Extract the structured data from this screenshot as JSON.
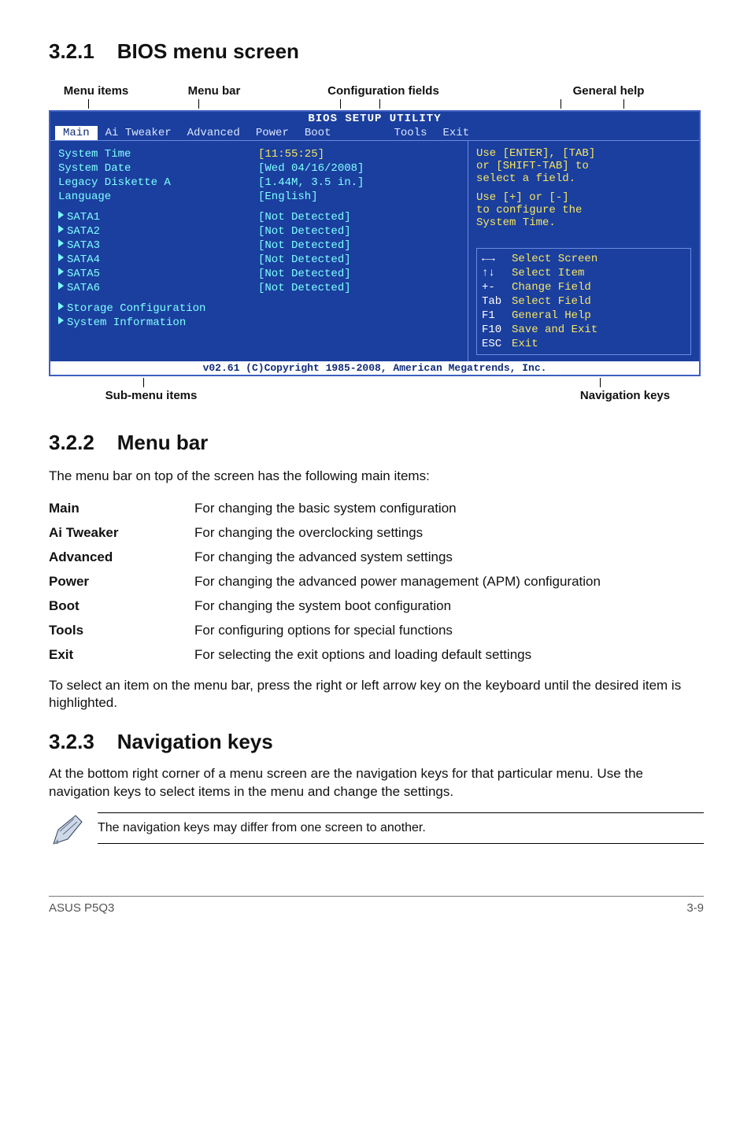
{
  "section321": {
    "num": "3.2.1",
    "title": "BIOS menu screen"
  },
  "topLabels": {
    "menuItems": "Menu items",
    "menuBar": "Menu bar",
    "configFields": "Configuration fields",
    "generalHelp": "General help"
  },
  "bios": {
    "title": "BIOS SETUP UTILITY",
    "menubar": [
      "Main",
      "Ai Tweaker",
      "Advanced",
      "Power",
      "Boot",
      "Tools",
      "Exit"
    ],
    "selectedIndex": 0,
    "left": {
      "items1": [
        "System Time",
        "System Date",
        "Legacy Diskette A",
        "Language"
      ],
      "sata": [
        "SATA1",
        "SATA2",
        "SATA3",
        "SATA4",
        "SATA5",
        "SATA6"
      ],
      "more": [
        "Storage Configuration",
        "System Information"
      ]
    },
    "mid": {
      "vals1": [
        "[11:55:25]",
        "[Wed 04/16/2008]",
        "[1.44M, 3.5 in.]",
        "[English]"
      ],
      "sataVals": [
        "[Not Detected]",
        "[Not Detected]",
        "[Not Detected]",
        "[Not Detected]",
        "[Not Detected]",
        "[Not Detected]"
      ]
    },
    "help": {
      "l1": "Use [ENTER], [TAB]",
      "l2": "or [SHIFT-TAB] to",
      "l3": "select a field.",
      "l4": "Use [+] or [-]",
      "l5": "to configure the",
      "l6": "System Time."
    },
    "nav": {
      "r1k": "←→",
      "r1": "Select Screen",
      "r2k": "↑↓",
      "r2": "Select Item",
      "r3k": "+-",
      "r3": "Change Field",
      "r4k": "Tab",
      "r4": "Select Field",
      "r5k": "F1",
      "r5": "General Help",
      "r6k": "F10",
      "r6": "Save and Exit",
      "r7k": "ESC",
      "r7": "Exit"
    },
    "footer": "v02.61 (C)Copyright 1985-2008, American Megatrends, Inc."
  },
  "bottomLabels": {
    "sub": "Sub-menu items",
    "nav": "Navigation keys"
  },
  "section322": {
    "num": "3.2.2",
    "title": "Menu bar",
    "intro": "The menu bar on top of the screen has the following main items:",
    "rows": [
      {
        "k": "Main",
        "v": "For changing the basic system configuration"
      },
      {
        "k": "Ai Tweaker",
        "v": "For changing the overclocking settings"
      },
      {
        "k": "Advanced",
        "v": "For changing the advanced system settings"
      },
      {
        "k": "Power",
        "v": "For changing the advanced power management (APM) configuration"
      },
      {
        "k": "Boot",
        "v": "For changing the system boot configuration"
      },
      {
        "k": "Tools",
        "v": "For configuring options for special functions"
      },
      {
        "k": "Exit",
        "v": "For selecting the exit options and loading default settings"
      }
    ],
    "outro": "To select an item on the menu bar, press the right or left arrow key on the keyboard until the desired item is highlighted."
  },
  "section323": {
    "num": "3.2.3",
    "title": "Navigation keys",
    "body": "At the bottom right corner of a menu screen are the navigation keys for that particular menu. Use the navigation keys to select items in the menu and change the settings.",
    "note": "The navigation keys may differ from one screen to another."
  },
  "footer": {
    "left": "ASUS P5Q3",
    "right": "3-9"
  }
}
